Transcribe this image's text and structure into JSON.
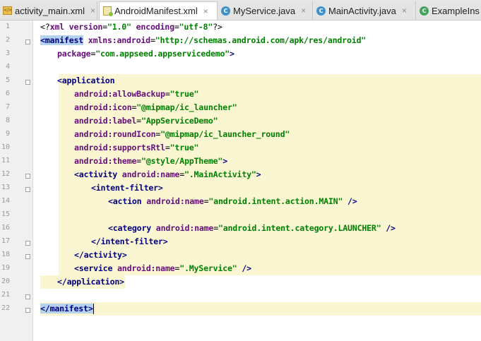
{
  "tabs": [
    {
      "label": "activity_main.xml",
      "icon": "xml-file-icon"
    },
    {
      "label": "AndroidManifest.xml",
      "icon": "manifest-file-icon",
      "active": true
    },
    {
      "label": "MyService.java",
      "icon": "class-icon"
    },
    {
      "label": "MainActivity.java",
      "icon": "class-icon"
    },
    {
      "label": "ExampleIns",
      "icon": "class-icon"
    }
  ],
  "tab_close_symbol": "×",
  "line_numbers": [
    "1",
    "2",
    "3",
    "4",
    "5",
    "6",
    "7",
    "8",
    "9",
    "10",
    "11",
    "12",
    "13",
    "14",
    "15",
    "16",
    "17",
    "18",
    "19",
    "20",
    "21",
    "22"
  ],
  "code": {
    "l1": {
      "a": "<?",
      "b": "xml version",
      "c": "=",
      "d": "\"1.0\"",
      "e": " encoding",
      "f": "=",
      "g": "\"utf-8\"",
      "h": "?>"
    },
    "l2": {
      "a": "<",
      "b": "manifest",
      "c": " xmlns:",
      "d": "android",
      "e": "=",
      "f": "\"http://schemas.android.com/apk/res/android\""
    },
    "l3": {
      "a": "package",
      "b": "=",
      "c": "\"com.appseed.appservicedemo\"",
      "d": ">"
    },
    "l5": {
      "a": "<",
      "b": "application"
    },
    "l6": {
      "a": "android:",
      "b": "allowBackup",
      "c": "=",
      "d": "\"true\""
    },
    "l7": {
      "a": "android:",
      "b": "icon",
      "c": "=",
      "d": "\"@mipmap/ic_launcher\""
    },
    "l8": {
      "a": "android:",
      "b": "label",
      "c": "=",
      "d": "\"AppServiceDemo\""
    },
    "l9": {
      "a": "android:",
      "b": "roundIcon",
      "c": "=",
      "d": "\"@mipmap/ic_launcher_round\""
    },
    "l10": {
      "a": "android:",
      "b": "supportsRtl",
      "c": "=",
      "d": "\"true\""
    },
    "l11": {
      "a": "android:",
      "b": "theme",
      "c": "=",
      "d": "\"@style/AppTheme\"",
      "e": ">"
    },
    "l12": {
      "a": "<",
      "b": "activity",
      "c": " android:",
      "d": "name",
      "e": "=",
      "f": "\".MainActivity\"",
      "g": ">"
    },
    "l13": {
      "a": "<",
      "b": "intent-filter",
      "c": ">"
    },
    "l14": {
      "a": "<",
      "b": "action",
      "c": " android:",
      "d": "name",
      "e": "=",
      "f": "\"android.intent.action.MAIN\"",
      "g": " />"
    },
    "l16": {
      "a": "<",
      "b": "category",
      "c": " android:",
      "d": "name",
      "e": "=",
      "f": "\"android.intent.category.LAUNCHER\"",
      "g": " />"
    },
    "l17": {
      "a": "</",
      "b": "intent-filter",
      "c": ">"
    },
    "l18": {
      "a": "</",
      "b": "activity",
      "c": ">"
    },
    "l19": {
      "a": "<",
      "b": "service",
      "c": " android:",
      "d": "name",
      "e": "=",
      "f": "\".MyService\"",
      "g": " />"
    },
    "l20": {
      "a": "</",
      "b": "application",
      "c": ">"
    },
    "l22": {
      "a": "</",
      "b": "manifest",
      "c": ">"
    }
  },
  "colors": {
    "tag": "#000080",
    "attr": "#660e7a",
    "value": "#008000",
    "highlight": "#fbf6d2",
    "selection": "#b5d3ef"
  }
}
